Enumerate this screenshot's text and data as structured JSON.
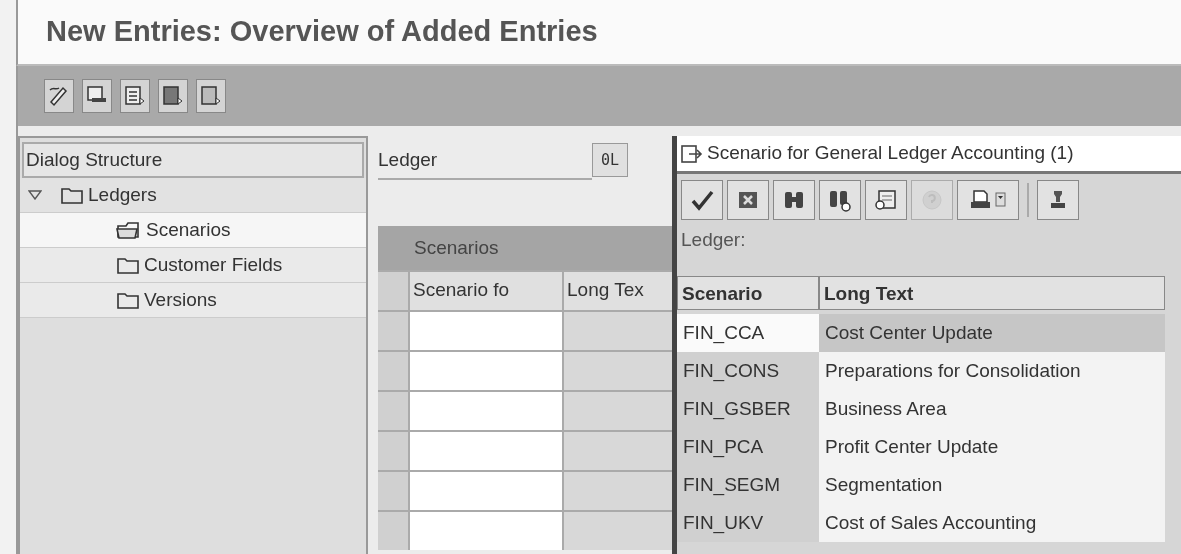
{
  "window": {
    "title": "New Entries: Overview of Added Entries"
  },
  "toolbar": [
    {
      "kind": "change"
    },
    {
      "kind": "screen"
    },
    {
      "kind": "list"
    },
    {
      "kind": "next"
    },
    {
      "kind": "last"
    }
  ],
  "dialog_structure": {
    "title": "Dialog Structure",
    "items": [
      {
        "label": "Ledgers",
        "expanded": true,
        "selected": false,
        "children": [
          {
            "label": "Scenarios",
            "selected": true
          },
          {
            "label": "Customer Fields",
            "selected": false
          },
          {
            "label": "Versions",
            "selected": false
          }
        ]
      }
    ]
  },
  "ledger_field": {
    "label": "Ledger",
    "value": "0L"
  },
  "scenarios_table": {
    "title": "Scenarios",
    "columns": [
      "Scenario fo",
      "Long Tex"
    ]
  },
  "popup": {
    "title": "Scenario for General Ledger Accounting (1)",
    "toolbar": [
      {
        "kind": "check",
        "disabled": false
      },
      {
        "kind": "cancel",
        "disabled": false
      },
      {
        "kind": "find",
        "disabled": false
      },
      {
        "kind": "find_next",
        "disabled": false
      },
      {
        "kind": "layout",
        "disabled": false
      },
      {
        "kind": "help",
        "disabled": true
      },
      {
        "kind": "print",
        "disabled": false
      },
      {
        "kind": "filter",
        "disabled": false
      }
    ],
    "ledger_label": "Ledger:",
    "columns": [
      "Scenario",
      "Long Text"
    ],
    "rows": [
      {
        "scenario": "FIN_CCA",
        "long_text": "Cost Center Update",
        "selected": true
      },
      {
        "scenario": "FIN_CONS",
        "long_text": "Preparations for Consolidation",
        "selected": false
      },
      {
        "scenario": "FIN_GSBER",
        "long_text": "Business Area",
        "selected": false
      },
      {
        "scenario": "FIN_PCA",
        "long_text": "Profit Center Update",
        "selected": false
      },
      {
        "scenario": "FIN_SEGM",
        "long_text": "Segmentation",
        "selected": false
      },
      {
        "scenario": "FIN_UKV",
        "long_text": "Cost of Sales Accounting",
        "selected": false
      }
    ]
  }
}
